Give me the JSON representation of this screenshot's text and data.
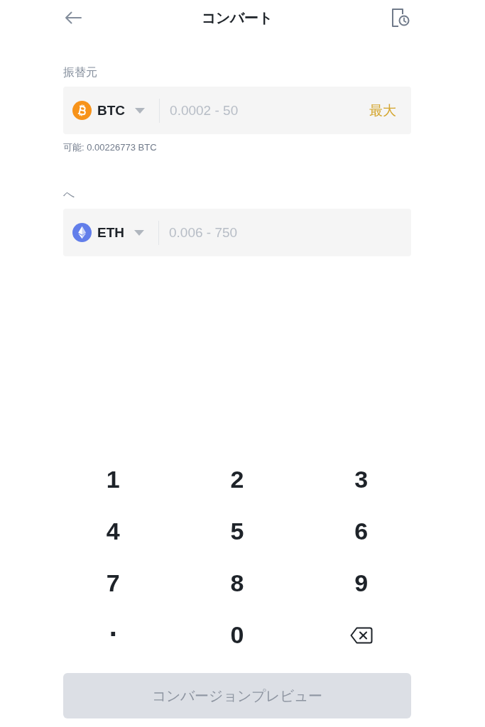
{
  "header": {
    "title": "コンバート"
  },
  "fields": [
    {
      "label": "振替元",
      "coin": {
        "kind": "bitcoin",
        "symbol": "BTC"
      },
      "placeholder": "0.0002 - 50",
      "max": "最大",
      "balance": "可能: 0.00226773 BTC"
    },
    {
      "label": "へ",
      "coin": {
        "kind": "ether",
        "symbol": "ETH"
      },
      "placeholder": "0.006 - 750"
    }
  ],
  "keypad": [
    {
      "kind": "digit",
      "label": "1"
    },
    {
      "kind": "digit",
      "label": "2"
    },
    {
      "kind": "digit",
      "label": "3"
    },
    {
      "kind": "digit",
      "label": "4"
    },
    {
      "kind": "digit",
      "label": "5"
    },
    {
      "kind": "digit",
      "label": "6"
    },
    {
      "kind": "digit",
      "label": "7"
    },
    {
      "kind": "digit",
      "label": "8"
    },
    {
      "kind": "digit",
      "label": "9"
    },
    {
      "kind": "decimal",
      "label": "."
    },
    {
      "kind": "digit",
      "label": "0"
    },
    {
      "kind": "backspace"
    }
  ],
  "button": {
    "label": "コンバージョンプレビュー",
    "disabled": true
  }
}
